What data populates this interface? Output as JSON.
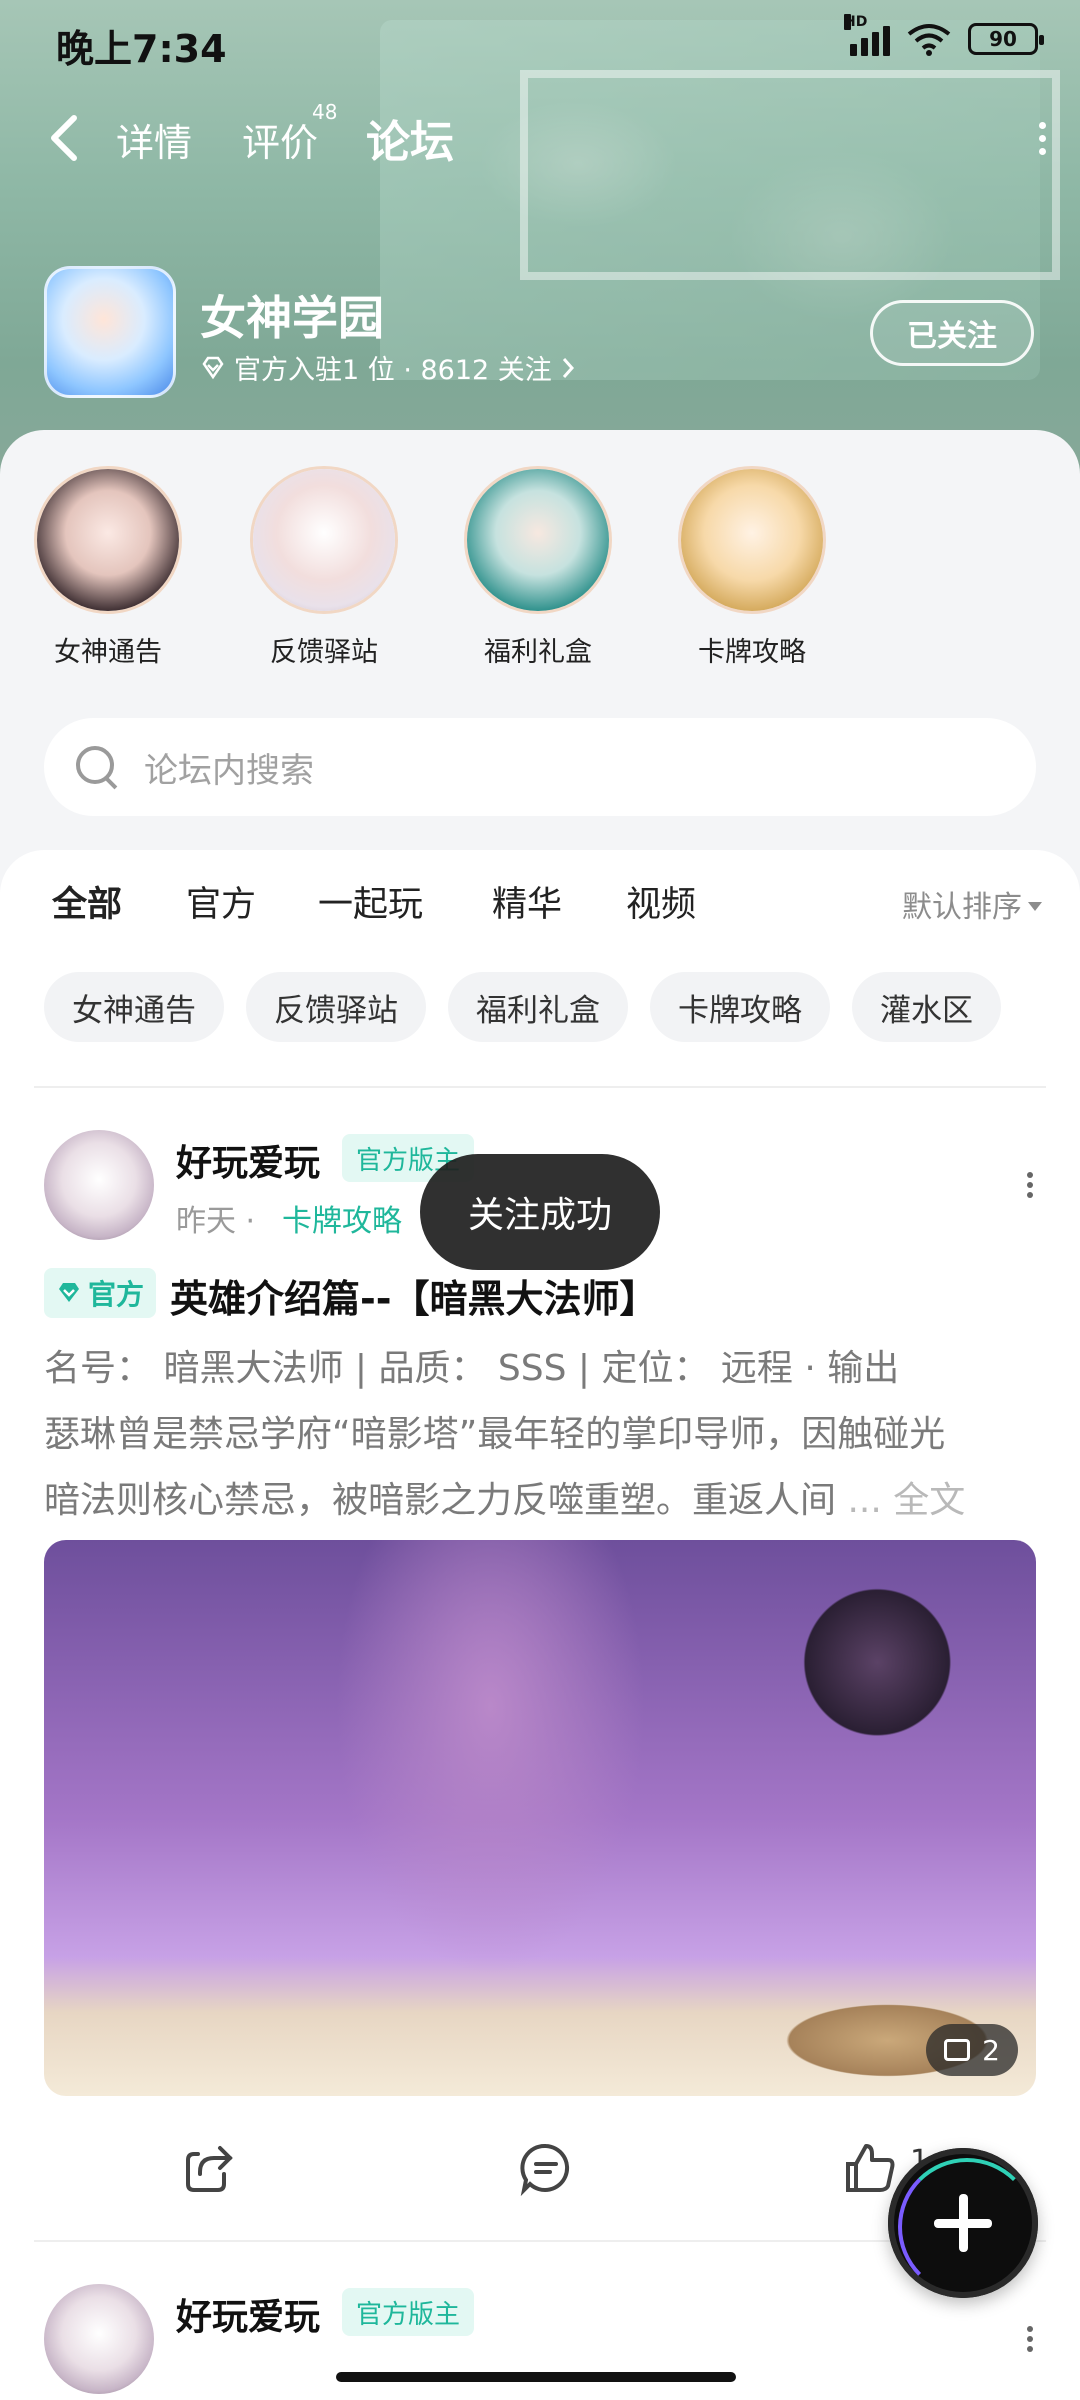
{
  "status_bar": {
    "time": "晚上7:34",
    "battery": "90",
    "network": "HD"
  },
  "nav": {
    "tabs": [
      {
        "label": "详情"
      },
      {
        "label": "评价",
        "badge": "48"
      },
      {
        "label": "论坛"
      }
    ]
  },
  "game": {
    "name": "女神学园",
    "meta": "官方入驻1 位 · 8612 关注",
    "follow_label": "已关注"
  },
  "quick_links": [
    {
      "label": "女神通告"
    },
    {
      "label": "反馈驿站"
    },
    {
      "label": "福利礼盒"
    },
    {
      "label": "卡牌攻略"
    }
  ],
  "search": {
    "placeholder": "论坛内搜索"
  },
  "feed_tabs": [
    {
      "label": "全部"
    },
    {
      "label": "官方"
    },
    {
      "label": "一起玩"
    },
    {
      "label": "精华"
    },
    {
      "label": "视频"
    }
  ],
  "sort_label": "默认排序",
  "chips": [
    {
      "label": "女神通告"
    },
    {
      "label": "反馈驿站"
    },
    {
      "label": "福利礼盒"
    },
    {
      "label": "卡牌攻略"
    },
    {
      "label": "灌水区"
    }
  ],
  "post": {
    "author": "好玩爱玩",
    "badge": "官方版主",
    "time": "昨天 ·",
    "category": "卡牌攻略",
    "official_tag": "官方",
    "title": "英雄介绍篇--【暗黑大法师】",
    "body_lines": [
      "名号： 暗黑大法师 | 品质： SSS | 定位： 远程 · 输出",
      "瑟琳曾是禁忌学府“暗影塔”最年轻的掌印导师，因触碰光",
      "暗法则核心禁忌，被暗影之力反噬重塑。重返人间"
    ],
    "ellipsis": " ... ",
    "full_text": "全文",
    "image_count": "2",
    "like_count": "1"
  },
  "post2": {
    "author": "好玩爱玩",
    "badge": "官方版主"
  },
  "toast": "关注成功",
  "colors": {
    "accent": "#2fd1b6",
    "official_green": "#1fb79b"
  }
}
